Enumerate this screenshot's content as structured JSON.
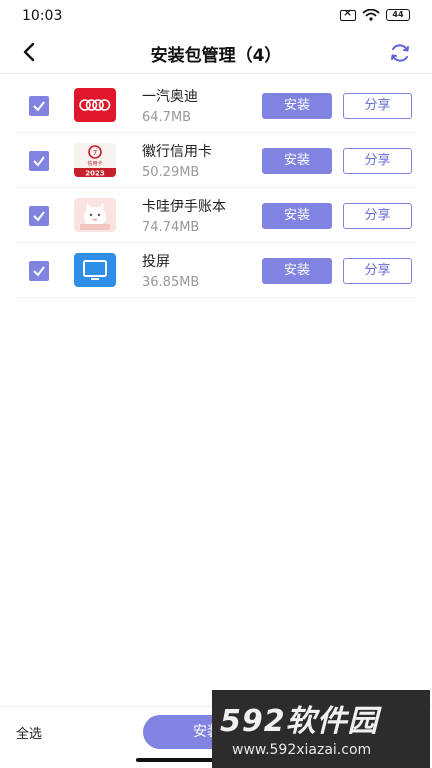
{
  "status_bar": {
    "time": "10:03",
    "battery": "44"
  },
  "header": {
    "title": "安装包管理（4）"
  },
  "apps": [
    {
      "name": "一汽奥迪",
      "size": "64.7MB",
      "install_label": "安装",
      "share_label": "分享",
      "icon": "audi-logo-icon"
    },
    {
      "name": "徽行信用卡",
      "size": "50.29MB",
      "install_label": "安装",
      "share_label": "分享",
      "icon": "credit-card-logo-icon",
      "icon_text": "信用卡",
      "icon_year": "2023"
    },
    {
      "name": "卡哇伊手账本",
      "size": "74.74MB",
      "install_label": "安装",
      "share_label": "分享",
      "icon": "cat-notebook-icon"
    },
    {
      "name": "投屏",
      "size": "36.85MB",
      "install_label": "安装",
      "share_label": "分享",
      "icon": "screen-cast-icon"
    }
  ],
  "bottom": {
    "select_all": "全选",
    "install_label": "安装"
  },
  "watermark": {
    "brand": "592软件园",
    "url": "www.592xiazai.com"
  },
  "colors": {
    "accent": "#8084e0",
    "audi_red": "#e0162b"
  }
}
